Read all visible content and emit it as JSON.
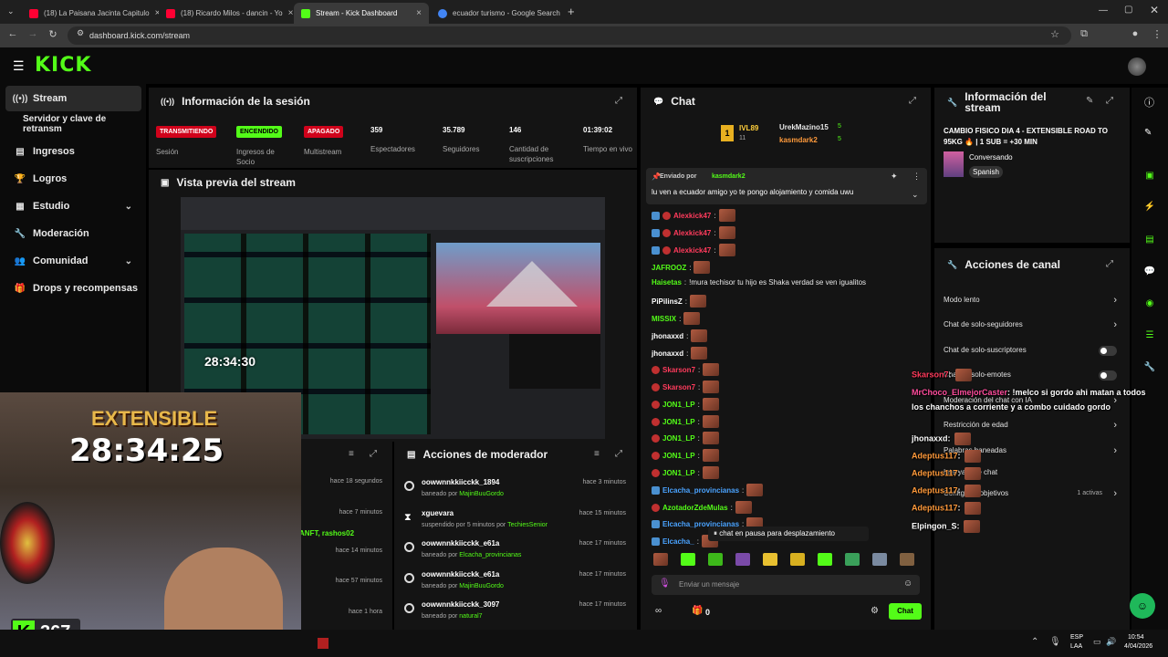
{
  "browser": {
    "tabs": [
      {
        "label": "(18) La Paisana Jacinta Capitulo",
        "color": "#ff0033"
      },
      {
        "label": "(18) Ricardo Milos - dancin - Yo",
        "color": "#ff0033"
      },
      {
        "label": "Stream - Kick Dashboard",
        "color": "#53fc18"
      },
      {
        "label": "ecuador turismo - Google Search",
        "color": "#4285f4"
      }
    ],
    "url": "dashboard.kick.com/stream"
  },
  "brand": {
    "logo": "KICK",
    "accent": "#53fc18"
  },
  "sidebar": {
    "items": [
      {
        "label": "Stream",
        "icon": "broadcast-icon",
        "glyph": "((•))",
        "active": true
      },
      {
        "label": "Servidor y clave de retransm",
        "icon": "",
        "glyph": ""
      },
      {
        "label": "Ingresos",
        "icon": "chart-icon",
        "glyph": "▤"
      },
      {
        "label": "Logros",
        "icon": "trophy-icon",
        "glyph": "🏆"
      },
      {
        "label": "Estudio",
        "icon": "grid-icon",
        "glyph": "▦",
        "chevron": true
      },
      {
        "label": "Moderación",
        "icon": "wrench-icon",
        "glyph": "🔧"
      },
      {
        "label": "Comunidad",
        "icon": "people-icon",
        "glyph": "👥",
        "chevron": true
      },
      {
        "label": "Drops y recompensas",
        "icon": "gift-icon",
        "glyph": "🎁"
      }
    ]
  },
  "session": {
    "title": "Información de la sesión",
    "badges": [
      {
        "text": "TRANSMITIENDO",
        "label": "Sesión",
        "color": "#d0021b"
      },
      {
        "text": "ENCENDIDO",
        "label": "Ingresos de Socio",
        "color": "#53fc18"
      },
      {
        "text": "APAGADO",
        "label": "Multistream",
        "color": "#d0021b"
      }
    ],
    "stats": [
      {
        "value": "359",
        "label": "Espectadores"
      },
      {
        "value": "35.789",
        "label": "Seguidores"
      },
      {
        "value": "146",
        "label": "Cantidad de suscripciones"
      },
      {
        "value": "01:39:02",
        "label": "Tiempo en vivo"
      }
    ]
  },
  "preview": {
    "title": "Vista previa del stream"
  },
  "activity": {
    "times": [
      "hace 18 segundos",
      "hace 7 minutos",
      "hace 14 minutos",
      "hace 57 minutos",
      "hace 1 hora"
    ],
    "snippet": "ANFT, rashos02"
  },
  "mod_actions": {
    "title": "Acciones de moderador",
    "rows": [
      {
        "name": "oowwnnkkiicckk_1894",
        "action": "baneado por",
        "by": "MajinBuuGordo",
        "time": "hace 3 minutos",
        "icon": "ban-icon"
      },
      {
        "name": "xguevara",
        "action": "suspendido por 5 minutos por",
        "by": "TechiesSenior",
        "time": "hace 15 minutos",
        "icon": "hourglass-icon"
      },
      {
        "name": "oowwnnkkiicckk_e61a",
        "action": "baneado por",
        "by": "Elcacha_provincianas",
        "time": "hace 17 minutos",
        "icon": "ban-icon"
      },
      {
        "name": "oowwnnkkiicckk_e61a",
        "action": "baneado por",
        "by": "MajinBuuGordo",
        "time": "hace 17 minutos",
        "icon": "ban-icon"
      },
      {
        "name": "oowwnnkkiicckk_3097",
        "action": "baneado por",
        "by": "natural7",
        "time": "hace 17 minutos",
        "icon": "ban-icon"
      }
    ]
  },
  "chat": {
    "title": "Chat",
    "leaderboard": [
      {
        "name": "IVL89",
        "count": "11"
      },
      {
        "name": "UrekMazino15",
        "count": "5"
      },
      {
        "name": "kasmdark2",
        "count": "5"
      }
    ],
    "pinned": {
      "by_label": "Enviado por",
      "by": "kasmdark2",
      "text": "lu ven a ecuador amigo yo te pongo alojamiento y comida uwu"
    },
    "messages": [
      {
        "user": "Alexkick47",
        "color": "#ff3b5c",
        "text": "",
        "emote": true
      },
      {
        "user": "Alexkick47",
        "color": "#ff3b5c",
        "text": "",
        "emote": true
      },
      {
        "user": "Alexkick47",
        "color": "#ff3b5c",
        "text": "",
        "emote": true
      },
      {
        "user": "JAFROOZ",
        "color": "#53fc18",
        "text": "",
        "emote": true
      },
      {
        "user": "Haisetas",
        "color": "#53fc18",
        "text": "!mura techisor tu hijo es Shaka verdad se ven igualitos",
        "emote": false
      },
      {
        "user": "PiPilinsZ",
        "color": "#ffffff",
        "text": "",
        "emote": true
      },
      {
        "user": "MISSIX",
        "color": "#53fc18",
        "text": "",
        "emote": true
      },
      {
        "user": "jhonaxxd",
        "color": "#ffffff",
        "text": "",
        "emote": true
      },
      {
        "user": "jhonaxxd",
        "color": "#ffffff",
        "text": "",
        "emote": true
      },
      {
        "user": "Skarson7",
        "color": "#ff3b5c",
        "text": "",
        "emote": true
      },
      {
        "user": "Skarson7",
        "color": "#ff3b5c",
        "text": "",
        "emote": true
      },
      {
        "user": "JON1_LP",
        "color": "#53fc18",
        "text": "",
        "emote": true
      },
      {
        "user": "JON1_LP",
        "color": "#53fc18",
        "text": "",
        "emote": true
      },
      {
        "user": "JON1_LP",
        "color": "#53fc18",
        "text": "",
        "emote": true
      },
      {
        "user": "JON1_LP",
        "color": "#53fc18",
        "text": "",
        "emote": true
      },
      {
        "user": "JON1_LP",
        "color": "#53fc18",
        "text": "",
        "emote": true
      },
      {
        "user": "Elcacha_provincianas",
        "color": "#4aa3ff",
        "text": "",
        "emote": true
      },
      {
        "user": "AzotadorZdeMulas",
        "color": "#53fc18",
        "text": "",
        "emote": true
      },
      {
        "user": "Elcacha_provincianas",
        "color": "#4aa3ff",
        "text": "",
        "emote": true
      },
      {
        "user": "Elcacha_",
        "color": "#4aa3ff",
        "text": "",
        "emote": true
      }
    ],
    "paused": "chat en pausa para desplazamiento",
    "input_placeholder": "Enviar un mensaje",
    "points": "0",
    "send_label": "Chat"
  },
  "stream_info": {
    "title": "Información del stream",
    "stream_title": "CAMBIO FISICO DIA 4 - EXTENSIBLE ROAD TO 95KG 🔥 | 1 SUB = +30 MIN",
    "category": "Conversando",
    "language": "Spanish"
  },
  "channel_actions": {
    "title": "Acciones de canal",
    "rows": [
      {
        "label": "Modo lento",
        "type": "arrow"
      },
      {
        "label": "Chat de solo-seguidores",
        "type": "arrow"
      },
      {
        "label": "Chat de solo-suscriptores",
        "type": "toggle"
      },
      {
        "label": "Chat de solo-emotes",
        "type": "toggle"
      },
      {
        "label": "Moderación del chat con IA",
        "type": "arrow"
      },
      {
        "label": "Restricción de edad",
        "type": "arrow"
      },
      {
        "label": "Palabras baneadas",
        "type": "arrow"
      },
      {
        "label": "Intervalo de chat",
        "type": "none"
      },
      {
        "label": "Configurar objetivos",
        "type": "arrow",
        "extra": "1 activas"
      }
    ]
  },
  "overlay": {
    "timer": "28:34:25",
    "timer_label": "EXTENSIBLE",
    "viewers": "367",
    "preview_timer": "28:34:30",
    "chat": [
      {
        "user": "Skarson7",
        "color": "#ff3b5c",
        "text": ":"
      },
      {
        "user": "MrChoco_ElmejorCaster",
        "color": "#ff4d9d",
        "text": ": !melco si gordo ahi matan a todos los chanchos a corriente y a combo cuidado gordo"
      },
      {
        "user": "jhonaxxd",
        "color": "#ffffff",
        "text": ":"
      },
      {
        "user": "Adeptus117",
        "color": "#ff9a3b",
        "text": ":"
      },
      {
        "user": "Adeptus117",
        "color": "#ff9a3b",
        "text": ":"
      },
      {
        "user": "Adeptus117",
        "color": "#ff9a3b",
        "text": ":"
      },
      {
        "user": "Adeptus117",
        "color": "#ff9a3b",
        "text": ":"
      },
      {
        "user": "Elpingon_S",
        "color": "#ffffff",
        "text": ":"
      }
    ]
  },
  "taskbar": {
    "lang1": "ESP",
    "lang2": "LAA",
    "time": "10:54",
    "date": "4/04/2026"
  }
}
